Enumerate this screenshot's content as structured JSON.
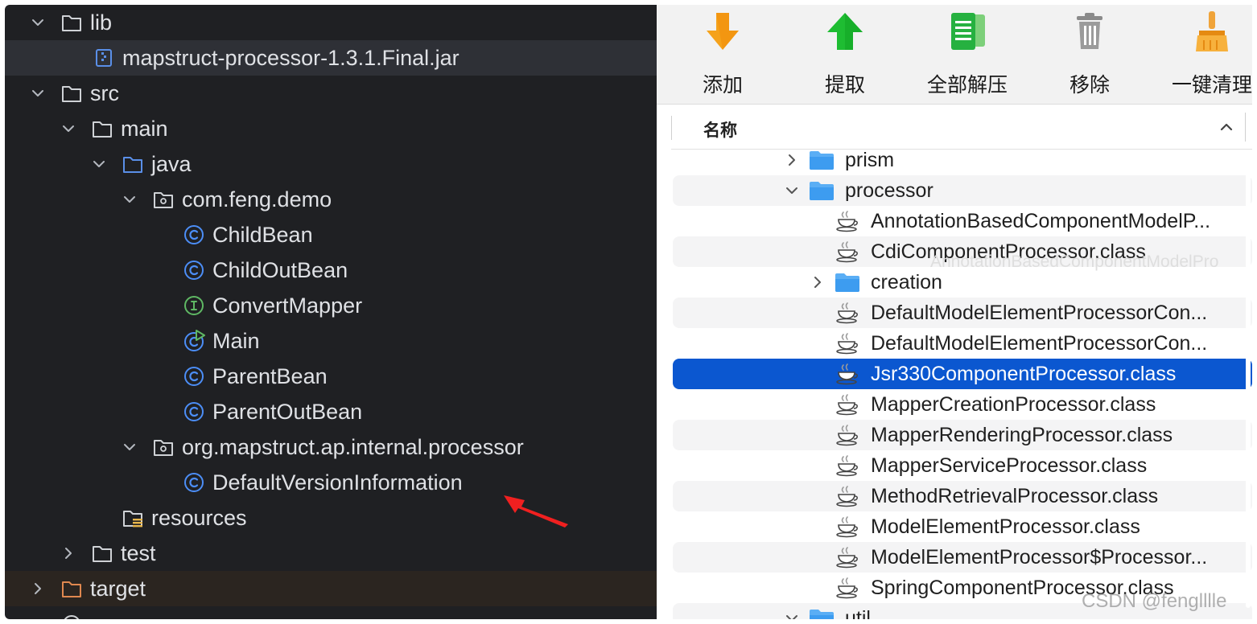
{
  "project_tree": {
    "items": [
      {
        "label": "lib",
        "type": "folder",
        "expanded": true
      },
      {
        "label": "mapstruct-processor-1.3.1.Final.jar",
        "type": "jar"
      },
      {
        "label": "src",
        "type": "folder",
        "expanded": true
      },
      {
        "label": "main",
        "type": "folder",
        "expanded": true
      },
      {
        "label": "java",
        "type": "source-folder",
        "expanded": true
      },
      {
        "label": "com.feng.demo",
        "type": "package",
        "expanded": true
      },
      {
        "label": "ChildBean",
        "type": "class"
      },
      {
        "label": "ChildOutBean",
        "type": "class"
      },
      {
        "label": "ConvertMapper",
        "type": "interface"
      },
      {
        "label": "Main",
        "type": "main-class"
      },
      {
        "label": "ParentBean",
        "type": "class"
      },
      {
        "label": "ParentOutBean",
        "type": "class"
      },
      {
        "label": "org.mapstruct.ap.internal.processor",
        "type": "package",
        "expanded": true
      },
      {
        "label": "DefaultVersionInformation",
        "type": "class"
      },
      {
        "label": "resources",
        "type": "resources-folder"
      },
      {
        "label": "test",
        "type": "folder",
        "expanded": false
      },
      {
        "label": "target",
        "type": "excluded-folder",
        "expanded": false
      }
    ]
  },
  "archive_app": {
    "toolbar": [
      {
        "label": "添加",
        "icon": "add-arrow-down-icon"
      },
      {
        "label": "提取",
        "icon": "extract-arrow-up-icon"
      },
      {
        "label": "全部解压",
        "icon": "extract-all-icon"
      },
      {
        "label": "移除",
        "icon": "trash-icon"
      },
      {
        "label": "一键清理",
        "icon": "broom-icon"
      }
    ],
    "column_header": {
      "name": "名称",
      "sort": "ascending"
    },
    "files": [
      {
        "label": "prism",
        "type": "folder",
        "expanded": false,
        "indent": 0
      },
      {
        "label": "processor",
        "type": "folder",
        "expanded": true,
        "indent": 0
      },
      {
        "label": "AnnotationBasedComponentModelP...",
        "type": "class",
        "indent": 1
      },
      {
        "label": "CdiComponentProcessor.class",
        "type": "class",
        "indent": 1
      },
      {
        "label": "creation",
        "type": "folder",
        "expanded": false,
        "indent": 1
      },
      {
        "label": "DefaultModelElementProcessorCon...",
        "type": "class",
        "indent": 1
      },
      {
        "label": "DefaultModelElementProcessorCon...",
        "type": "class",
        "indent": 1
      },
      {
        "label": "Jsr330ComponentProcessor.class",
        "type": "class",
        "indent": 1,
        "selected": true
      },
      {
        "label": "MapperCreationProcessor.class",
        "type": "class",
        "indent": 1
      },
      {
        "label": "MapperRenderingProcessor.class",
        "type": "class",
        "indent": 1
      },
      {
        "label": "MapperServiceProcessor.class",
        "type": "class",
        "indent": 1
      },
      {
        "label": "MethodRetrievalProcessor.class",
        "type": "class",
        "indent": 1
      },
      {
        "label": "ModelElementProcessor.class",
        "type": "class",
        "indent": 1
      },
      {
        "label": "ModelElementProcessor$Processor...",
        "type": "class",
        "indent": 1
      },
      {
        "label": "SpringComponentProcessor.class",
        "type": "class",
        "indent": 1
      },
      {
        "label": "util",
        "type": "folder",
        "expanded": true,
        "indent": 0
      }
    ],
    "tooltip_ghost": "AnnotationBasedComponentModelPro"
  },
  "watermark": "CSDN @fenglllle",
  "colors": {
    "ide_bg": "#1f2023",
    "ide_text": "#dfe1e5",
    "class_icon": "#4c8ef7",
    "interface_icon": "#5fb864",
    "folder_outline": "#cfd2d6",
    "selection_blue": "#0b57d0",
    "arrow_red": "#f02020"
  }
}
